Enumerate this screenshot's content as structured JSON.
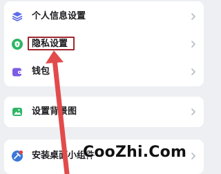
{
  "settings": {
    "group1": [
      {
        "label": "个人信息设置",
        "icon": "layers-icon",
        "color": "#5b6be8"
      },
      {
        "label": "隐私设置",
        "icon": "shield-icon",
        "color": "#2fb566"
      },
      {
        "label": "钱包",
        "icon": "wallet-icon",
        "color": "#7c5ce6"
      }
    ],
    "group2": [
      {
        "label": "设置背景图",
        "icon": "image-icon",
        "color": "#2fb566"
      }
    ],
    "group3": [
      {
        "label": "安装桌面小组件",
        "icon": "widget-icon",
        "color": "#3a79d8"
      }
    ]
  },
  "annotation": {
    "highlight_color": "#a1272f",
    "arrow_color": "#e24b4b",
    "target": "隐私设置"
  },
  "watermark": "CooZhi.Com"
}
